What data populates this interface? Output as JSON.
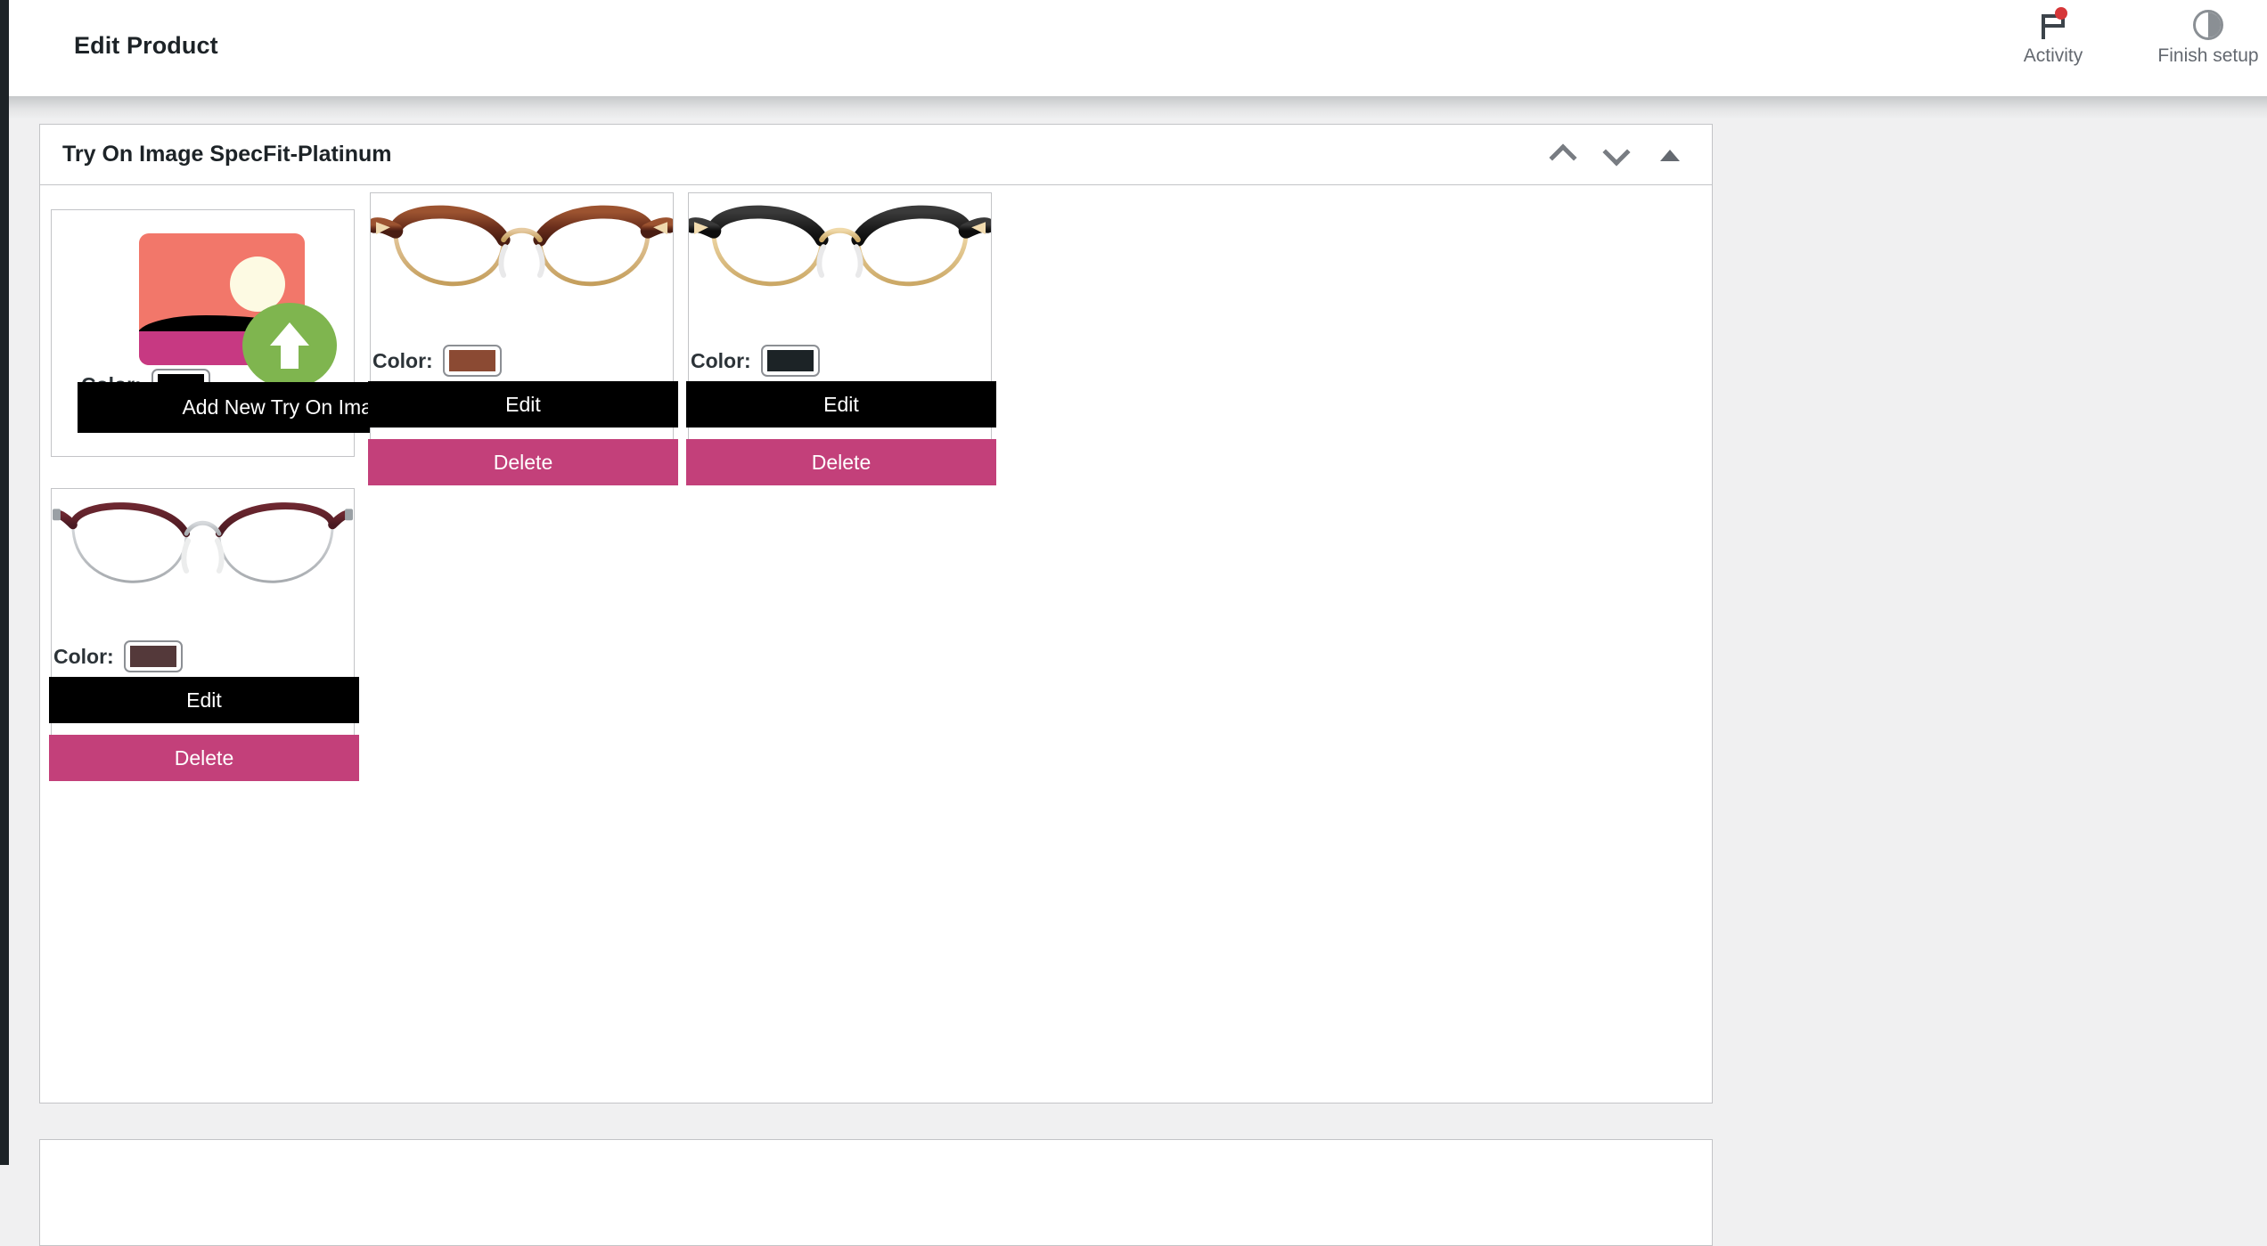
{
  "app": {
    "page_title": "Edit Product",
    "background_color": "#f0f0f1",
    "accent_dark": "#000000",
    "accent_pink": "#c3407a"
  },
  "topbar": {
    "title": "Edit Product",
    "actions": [
      {
        "label": "Activity",
        "icon": "flag-icon",
        "badge": true,
        "badge_color": "#d63638"
      },
      {
        "label": "Finish setup",
        "icon": "pie-progress-icon",
        "badge": false
      }
    ]
  },
  "metabox": {
    "title": "Try On Image SpecFit-Platinum",
    "controls": [
      {
        "name": "move-up",
        "icon": "chevron-up-icon"
      },
      {
        "name": "move-down",
        "icon": "chevron-down-icon"
      },
      {
        "name": "toggle-panel",
        "icon": "triangle-up-icon"
      }
    ]
  },
  "uploader": {
    "icon": "image-upload-icon",
    "color_label": "Color:",
    "color_value": "#000000",
    "add_button_label": "Add New Try On Image"
  },
  "items": [
    {
      "id": "tryon-1",
      "image_alt": "tortoiseshell browline eyeglasses with gold rims",
      "frame_top_color": "#6b2f1c",
      "frame_top_color2": "#9c5330",
      "frame_rim_color": "#d8b678",
      "color_label": "Color:",
      "color_value": "#8b4a33",
      "edit_label": "Edit",
      "delete_label": "Delete"
    },
    {
      "id": "tryon-2",
      "image_alt": "black browline eyeglasses with gold rims",
      "frame_top_color": "#1c1c1c",
      "frame_top_color2": "#2e2e2e",
      "frame_rim_color": "#e3c386",
      "color_label": "Color:",
      "color_value": "#1c2326",
      "edit_label": "Edit",
      "delete_label": "Delete"
    },
    {
      "id": "tryon-3",
      "image_alt": "burgundy wire round eyeglasses with silver rims",
      "frame_top_color": "#5a1e26",
      "frame_top_color2": "#6d2730",
      "frame_rim_color": "#b9bcc0",
      "color_label": "Color:",
      "color_value": "#54393a",
      "edit_label": "Edit",
      "delete_label": "Delete"
    }
  ]
}
